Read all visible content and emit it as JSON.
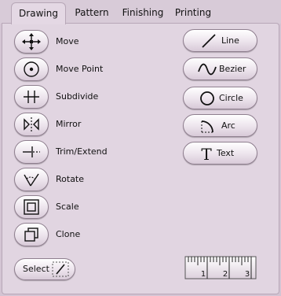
{
  "tabs": [
    {
      "label": "Drawing",
      "active": true
    },
    {
      "label": "Pattern",
      "active": false
    },
    {
      "label": "Finishing",
      "active": false
    },
    {
      "label": "Printing",
      "active": false
    }
  ],
  "tools": [
    {
      "label": "Move",
      "icon": "move-arrows-icon"
    },
    {
      "label": "Move Point",
      "icon": "move-point-icon"
    },
    {
      "label": "Subdivide",
      "icon": "subdivide-icon"
    },
    {
      "label": "Mirror",
      "icon": "mirror-icon"
    },
    {
      "label": "Trim/Extend",
      "icon": "trim-extend-icon"
    },
    {
      "label": "Rotate",
      "icon": "rotate-icon"
    },
    {
      "label": "Scale",
      "icon": "scale-icon"
    },
    {
      "label": "Clone",
      "icon": "clone-icon"
    }
  ],
  "shapes": [
    {
      "label": "Line",
      "icon": "line-icon"
    },
    {
      "label": "Bezier",
      "icon": "bezier-icon"
    },
    {
      "label": "Circle",
      "icon": "circle-icon"
    },
    {
      "label": "Arc",
      "icon": "arc-icon"
    },
    {
      "label": "Text",
      "icon": "text-icon"
    }
  ],
  "select": {
    "label": "Select",
    "icon": "select-icon"
  },
  "ruler": {
    "icon": "ruler-icon",
    "ticks": [
      "1",
      "2",
      "3"
    ]
  },
  "colors": {
    "background": "#d3c4d3",
    "panel": "#e1d5e1",
    "button_border": "#8f7f8f"
  }
}
